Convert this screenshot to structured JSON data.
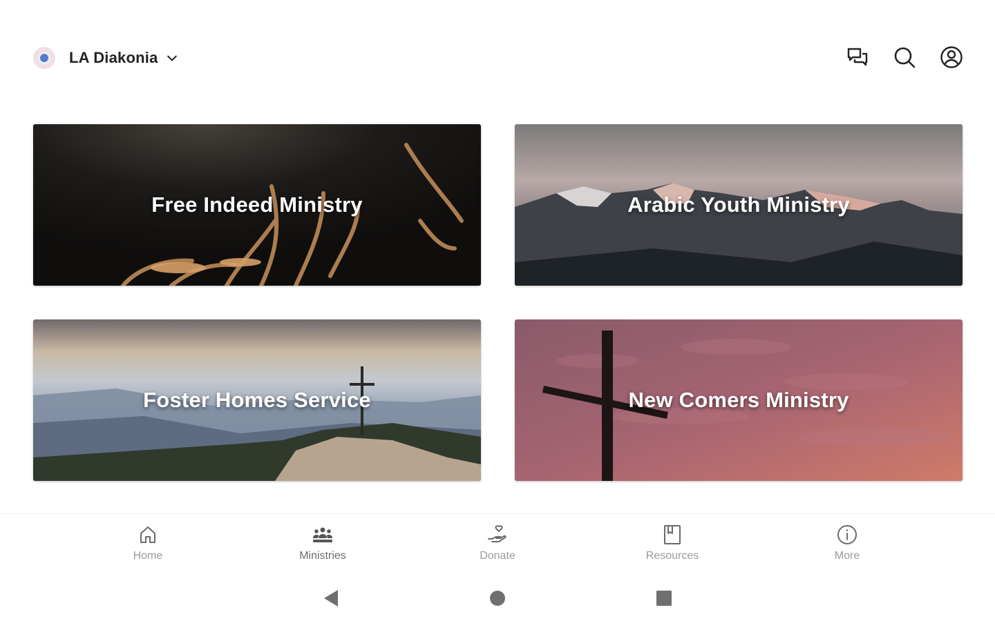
{
  "header": {
    "org_name": "LA Diakonia",
    "icons": [
      "chat-icon",
      "search-icon",
      "account-icon"
    ]
  },
  "ministries": [
    {
      "title": "Free Indeed Ministry"
    },
    {
      "title": "Arabic Youth Ministry"
    },
    {
      "title": "Foster Homes Service"
    },
    {
      "title": "New Comers Ministry"
    }
  ],
  "bottom_nav": {
    "active": "Ministries",
    "items": [
      {
        "label": "Home",
        "icon": "home-icon"
      },
      {
        "label": "Ministries",
        "icon": "ministries-icon"
      },
      {
        "label": "Donate",
        "icon": "donate-icon"
      },
      {
        "label": "Resources",
        "icon": "resources-icon"
      },
      {
        "label": "More",
        "icon": "info-icon"
      }
    ]
  },
  "system_nav": [
    "back-icon",
    "home-circle-icon",
    "recents-icon"
  ],
  "colors": {
    "text_primary": "#222222",
    "nav_label": "#9a9a9a",
    "nav_icon_active": "#555555"
  }
}
